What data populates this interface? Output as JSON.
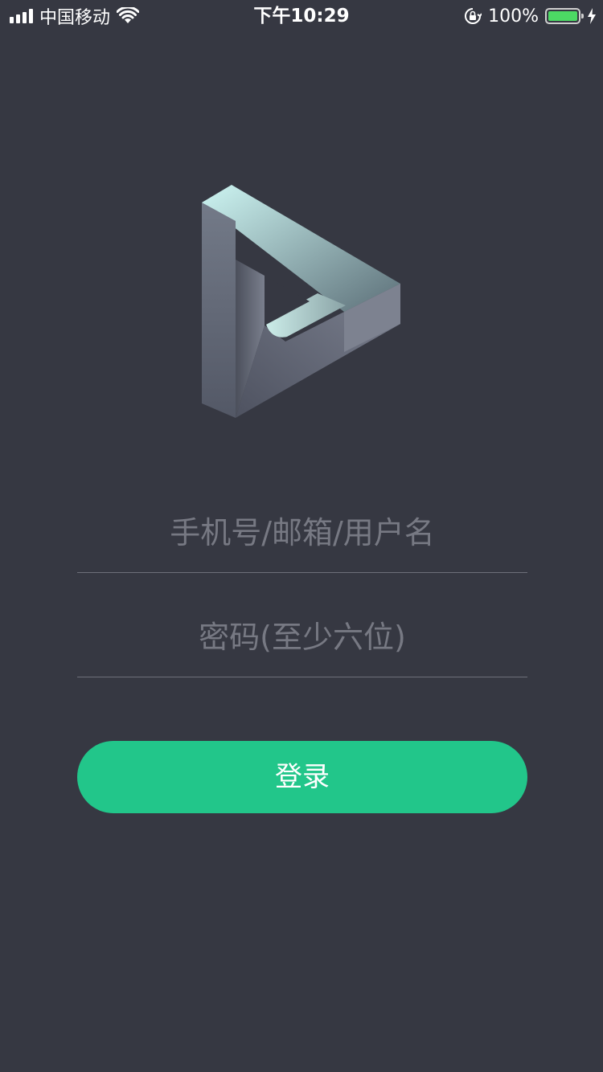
{
  "status_bar": {
    "carrier": "中国移动",
    "time": "下午10:29",
    "battery_percent": "100%",
    "battery_level": 1.0,
    "icons": [
      "signal-icon",
      "wifi-icon",
      "orientation-lock-icon",
      "battery-icon",
      "charging-icon"
    ]
  },
  "logo": {
    "icon": "impossible-triangle-play-logo"
  },
  "form": {
    "account_placeholder": "手机号/邮箱/用户名",
    "account_value": "",
    "password_placeholder": "密码(至少六位)",
    "password_value": "",
    "login_label": "登录"
  },
  "colors": {
    "background": "#363842",
    "accent": "#22c68a",
    "placeholder": "#777983",
    "divider": "#6e707a",
    "battery": "#4cd964"
  }
}
